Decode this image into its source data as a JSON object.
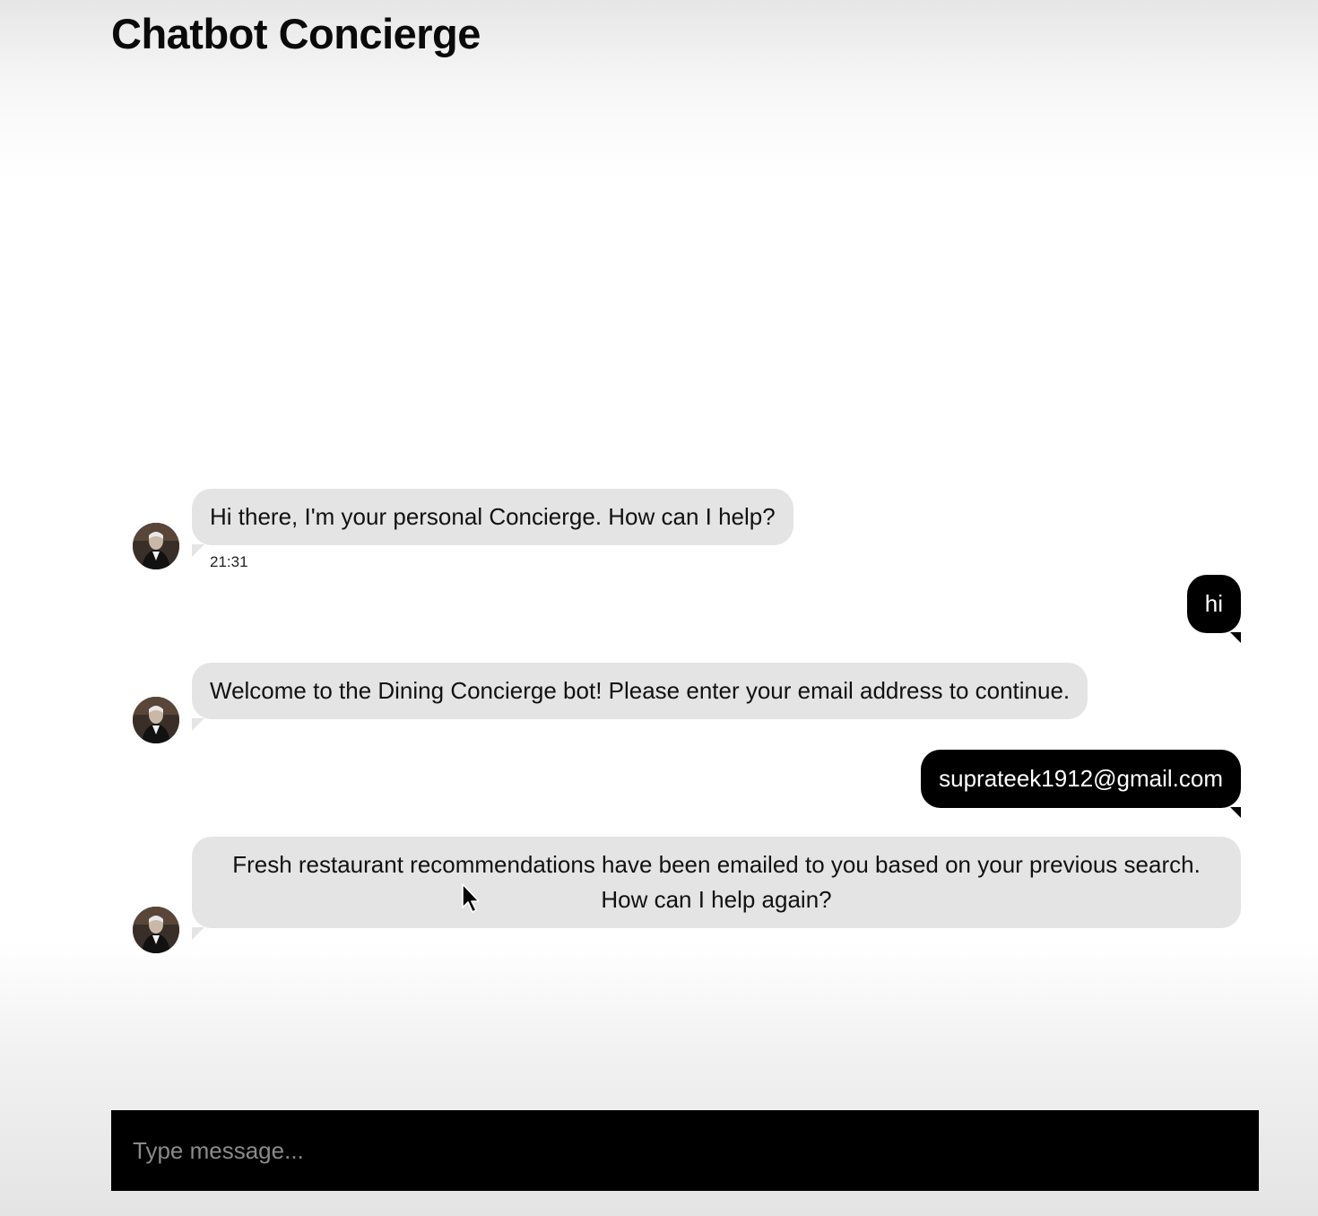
{
  "header": {
    "title": "Chatbot Concierge"
  },
  "messages": [
    {
      "sender": "bot",
      "text": "Hi there, I'm your personal Concierge. How can I help?",
      "time": "21:31",
      "avatar": "concierge-avatar"
    },
    {
      "sender": "user",
      "text": "hi"
    },
    {
      "sender": "bot",
      "text": "Welcome to the Dining Concierge bot! Please enter your email address to continue.",
      "avatar": "concierge-avatar"
    },
    {
      "sender": "user",
      "text": "suprateek1912@gmail.com"
    },
    {
      "sender": "bot",
      "text": "Fresh restaurant recommendations have been emailed to you based on your previous search. How can I help again?",
      "avatar": "concierge-avatar"
    }
  ],
  "composer": {
    "placeholder": "Type message...",
    "value": ""
  },
  "colors": {
    "bot_bubble": "#e4e4e4",
    "user_bubble": "#000000",
    "composer_bg": "#000000"
  }
}
